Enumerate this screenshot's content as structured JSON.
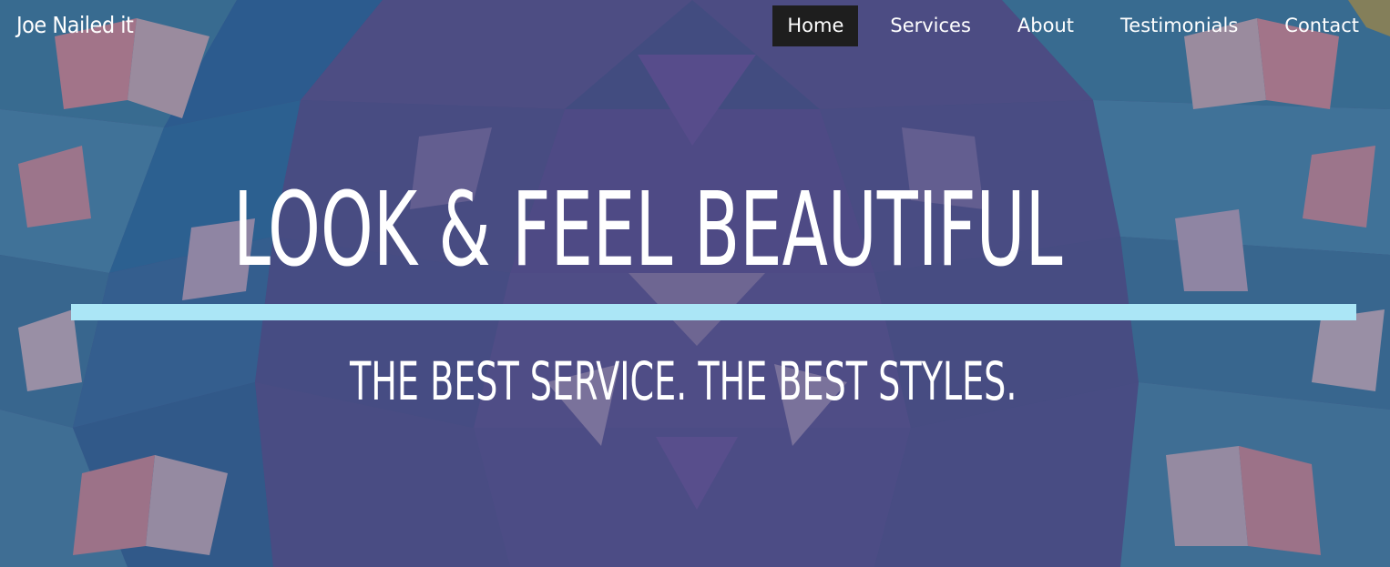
{
  "header": {
    "brand": "Joe Nailed it"
  },
  "nav": {
    "items": [
      {
        "label": "Home",
        "active": true
      },
      {
        "label": "Services",
        "active": false
      },
      {
        "label": "About",
        "active": false
      },
      {
        "label": "Testimonials",
        "active": false
      },
      {
        "label": "Contact",
        "active": false
      }
    ]
  },
  "hero": {
    "title": "LOOK & FEEL BEAUTIFUL",
    "subtitle": "THE BEST SERVICE. THE BEST STYLES."
  },
  "colors": {
    "nav_active_bg": "#1e1e1e",
    "divider": "#abe6f6",
    "text": "#ffffff"
  }
}
